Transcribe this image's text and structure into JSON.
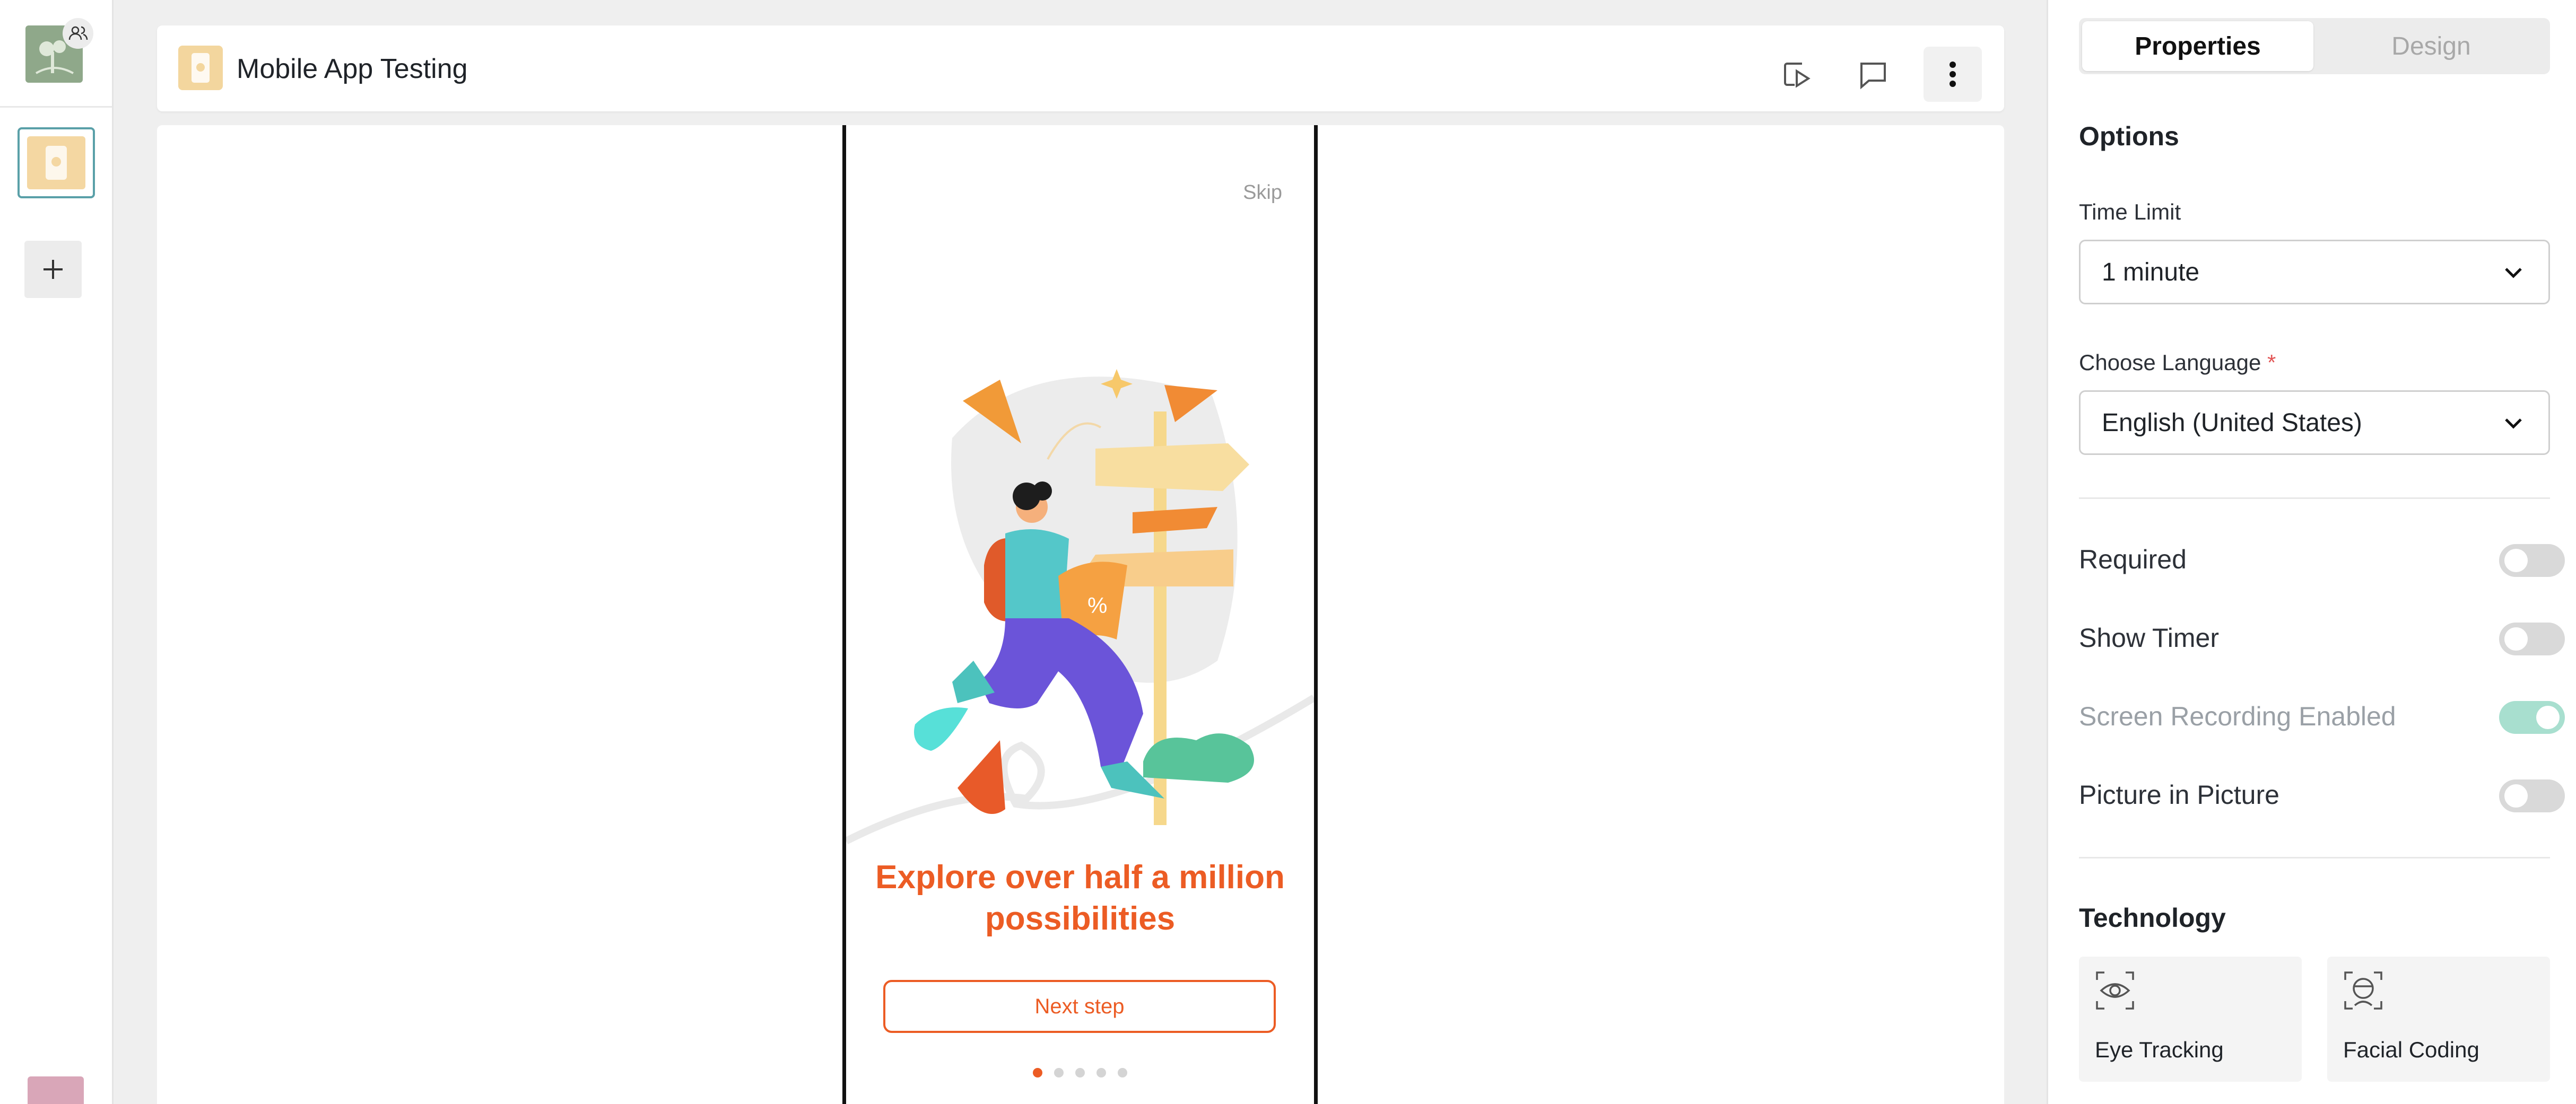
{
  "header": {
    "title": "Mobile App Testing"
  },
  "sidebar": {
    "logo_icon": "tree-logo-icon",
    "users_icon": "users-icon",
    "add_icon": "plus-icon"
  },
  "phone": {
    "skip": "Skip",
    "headline_line1": "Explore over half a million",
    "headline_line2": "possibilities",
    "next_button": "Next step",
    "dots_total": 5,
    "dots_active": 1
  },
  "panel": {
    "tabs": [
      {
        "label": "Properties",
        "active": true
      },
      {
        "label": "Design",
        "active": false
      }
    ],
    "options_title": "Options",
    "time_limit_label": "Time Limit",
    "time_limit_value": "1 minute",
    "language_label": "Choose Language",
    "language_required": "*",
    "language_value": "English (United States)",
    "toggles": [
      {
        "label": "Required",
        "on": false,
        "disabled": false
      },
      {
        "label": "Show Timer",
        "on": false,
        "disabled": false
      },
      {
        "label": "Screen Recording Enabled",
        "on": true,
        "disabled": true
      },
      {
        "label": "Picture in Picture",
        "on": false,
        "disabled": false
      }
    ],
    "technology_title": "Technology",
    "technology": [
      {
        "label": "Eye Tracking",
        "icon": "eye-tracking-icon"
      },
      {
        "label": "Facial Coding",
        "icon": "facial-coding-icon"
      }
    ]
  },
  "colors": {
    "accent": "#ec5c24",
    "thumb_border": "#5aa0a8",
    "toggle_on": "#a8dfcf"
  }
}
